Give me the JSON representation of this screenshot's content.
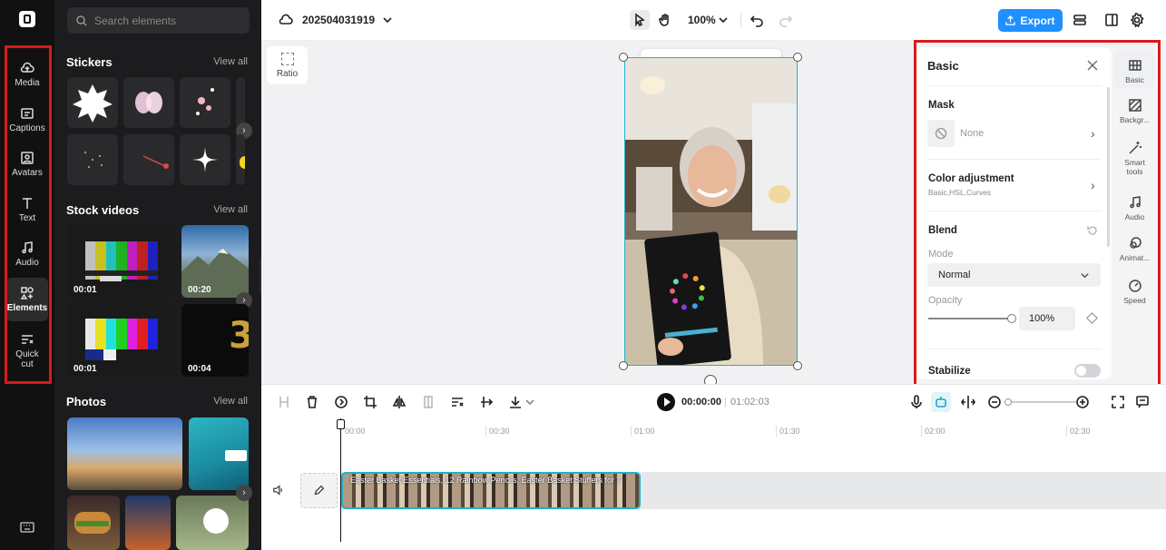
{
  "app": {
    "logo": "capcut-logo-icon"
  },
  "rail": {
    "items": [
      {
        "label": "Media",
        "icon": "cloud-upload-icon"
      },
      {
        "label": "Captions",
        "icon": "captions-icon"
      },
      {
        "label": "Avatars",
        "icon": "avatar-icon"
      },
      {
        "label": "Text",
        "icon": "text-icon"
      },
      {
        "label": "Audio",
        "icon": "music-icon"
      },
      {
        "label": "Elements",
        "icon": "elements-icon"
      },
      {
        "label": "Quick",
        "label2": "cut",
        "icon": "quick-cut-icon"
      }
    ],
    "bottom_icon": "keyboard-icon"
  },
  "panel": {
    "search_placeholder": "Search elements",
    "stickers_title": "Stickers",
    "stock_title": "Stock videos",
    "photos_title": "Photos",
    "view_all": "View all",
    "videos": [
      "00:01",
      "00:20",
      "00:01",
      "00:04"
    ]
  },
  "topbar": {
    "project_name": "202504031919",
    "zoom": "100%",
    "export_label": "Export"
  },
  "canvas": {
    "ratio_label": "Ratio"
  },
  "right_panel": {
    "title": "Basic",
    "mask_label": "Mask",
    "mask_value": "None",
    "color_adj_label": "Color adjustment",
    "color_adj_sub": "Basic,HSL,Curves",
    "blend_label": "Blend",
    "mode_label": "Mode",
    "mode_value": "Normal",
    "opacity_label": "Opacity",
    "opacity_value": "100%",
    "opacity_fraction": 1.0,
    "stabilize_label": "Stabilize"
  },
  "right_tabs": [
    {
      "label": "Basic"
    },
    {
      "label": "Backgr..."
    },
    {
      "label": "Smart tools"
    },
    {
      "label": "Audio"
    },
    {
      "label": "Animat..."
    },
    {
      "label": "Speed"
    }
  ],
  "playback": {
    "current": "00:00:00",
    "total": "01:02:03"
  },
  "timeline": {
    "ruler": [
      "00:00",
      "00:30",
      "01:00",
      "01:30",
      "02:00",
      "02:30"
    ],
    "clip_title": "Easter Basket Essentials, 12 Rainbow Pencils, Easter Basket Stuffers for T"
  },
  "colors": {
    "accent": "#1e90ff",
    "selection": "#20b2c8",
    "highlight": "#d81b1b"
  }
}
